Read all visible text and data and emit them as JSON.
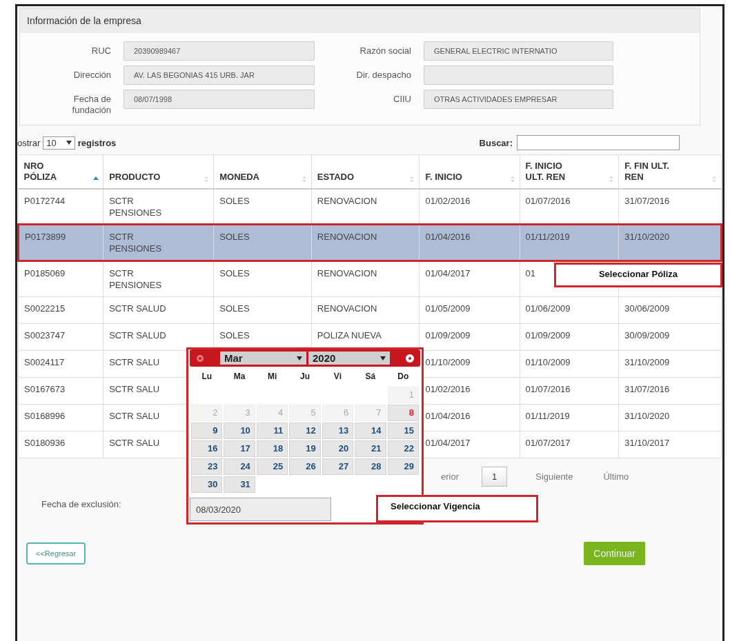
{
  "company_info": {
    "title": "Información de la empresa",
    "fields": [
      {
        "label": "RUC",
        "value": "20390989467"
      },
      {
        "label": "Razón social",
        "value": "GENERAL ELECTRIC INTERNATIO"
      },
      {
        "label": "Dirección",
        "value": "AV. LAS BEGONIAS 415 URB. JAR"
      },
      {
        "label": "Dir. despacho"
      },
      {
        "label": "Fecha de fundación",
        "value": "08/07/1998"
      },
      {
        "label": "CIIU",
        "value": "OTRAS ACTIVIDADES EMPRESAR"
      }
    ]
  },
  "table": {
    "length_menu": {
      "prefix": "ostrar",
      "value": "10",
      "suffix": "registros"
    },
    "search": {
      "label": "Buscar:"
    },
    "columns": [
      {
        "label": "NRO PÓLIZA",
        "sorted_ascending": true
      },
      {
        "label": "PRODUCTO",
        "sorted_ascending": false
      },
      {
        "label": "MONEDA",
        "sorted_ascending": false
      },
      {
        "label": "ESTADO",
        "sorted_ascending": false
      },
      {
        "label": "F. INICIO",
        "sorted_ascending": false
      },
      {
        "label": "F. INICIO ULT. REN",
        "sorted_ascending": false
      },
      {
        "label": "F. FIN ULT. REN",
        "sorted_ascending": false
      }
    ],
    "rows": [
      {
        "selected": false,
        "policy_no": "P0172744",
        "product": "SCTR PENSIONES",
        "currency": "SOLES",
        "status": "RENOVACION",
        "start": "01/02/2016",
        "renewal_start": "01/07/2016",
        "renewal_end": "31/07/2016"
      },
      {
        "selected": true,
        "callout": "Seleccionar Póliza",
        "policy_no": "P0173899",
        "product": "SCTR PENSIONES",
        "currency": "SOLES",
        "status": "RENOVACION",
        "start": "01/04/2016",
        "renewal_start": "01/11/2019",
        "renewal_end": "31/10/2020"
      },
      {
        "selected": false,
        "policy_no": "P0185069",
        "product": "SCTR PENSIONES",
        "currency": "SOLES",
        "status": "RENOVACION",
        "start": "01/04/2017",
        "renewal_start": "01"
      },
      {
        "selected": false,
        "policy_no": "S0022215",
        "product": "SCTR SALUD",
        "currency": "SOLES",
        "status": "RENOVACION",
        "start": "01/05/2009",
        "renewal_start": "01/06/2009",
        "renewal_end": "30/06/2009"
      },
      {
        "selected": false,
        "policy_no": "S0023747",
        "product": "SCTR SALUD",
        "currency": "SOLES",
        "status": "POLIZA NUEVA",
        "start": "01/09/2009",
        "renewal_start": "01/09/2009",
        "renewal_end": "30/09/2009"
      },
      {
        "selected": false,
        "policy_no": "S0024117",
        "product": "SCTR SALU",
        "start": "01/10/2009",
        "renewal_start": "01/10/2009",
        "renewal_end": "31/10/2009"
      },
      {
        "selected": false,
        "policy_no": "S0167673",
        "product": "SCTR SALU",
        "start": "01/02/2016",
        "renewal_start": "01/07/2016",
        "renewal_end": "31/07/2016"
      },
      {
        "selected": false,
        "policy_no": "S0168996",
        "product": "SCTR SALU",
        "start": "01/04/2016",
        "renewal_start": "01/11/2019",
        "renewal_end": "31/10/2020"
      },
      {
        "selected": false,
        "policy_no": "S0180936",
        "product": "SCTR SALU",
        "start": "01/04/2017",
        "renewal_start": "01/07/2017",
        "renewal_end": "31/10/2017"
      }
    ],
    "pagination": [
      {
        "label": "erior",
        "selected": false
      },
      {
        "label": "1",
        "selected": true
      },
      {
        "label": "Siguiente",
        "selected": false
      },
      {
        "label": "Último",
        "selected": false
      }
    ]
  },
  "calendar": {
    "month": "Mar",
    "year": "2020",
    "weekdays": [
      "Lu",
      "Ma",
      "Mi",
      "Ju",
      "Vi",
      "Sá",
      "Do"
    ],
    "weeks": [
      [
        {
          "kind": "blank"
        },
        {
          "kind": "blank"
        },
        {
          "kind": "blank"
        },
        {
          "kind": "blank"
        },
        {
          "kind": "blank"
        },
        {
          "kind": "blank"
        },
        {
          "kind": "day",
          "label": "1",
          "disabled": true,
          "today": false
        }
      ],
      [
        {
          "kind": "day",
          "label": "2",
          "disabled": true,
          "today": false
        },
        {
          "kind": "day",
          "label": "3",
          "disabled": true,
          "today": false
        },
        {
          "kind": "day",
          "label": "4",
          "disabled": true,
          "today": false
        },
        {
          "kind": "day",
          "label": "5",
          "disabled": true,
          "today": false
        },
        {
          "kind": "day",
          "label": "6",
          "disabled": true,
          "today": false
        },
        {
          "kind": "day",
          "label": "7",
          "disabled": true,
          "today": false
        },
        {
          "kind": "day",
          "label": "8",
          "disabled": false,
          "today": true
        }
      ],
      [
        {
          "kind": "day",
          "label": "9",
          "disabled": false,
          "today": false
        },
        {
          "kind": "day",
          "label": "10",
          "disabled": false,
          "today": false
        },
        {
          "kind": "day",
          "label": "11",
          "disabled": false,
          "today": false
        },
        {
          "kind": "day",
          "label": "12",
          "disabled": false,
          "today": false
        },
        {
          "kind": "day",
          "label": "13",
          "disabled": false,
          "today": false
        },
        {
          "kind": "day",
          "label": "14",
          "disabled": false,
          "today": false
        },
        {
          "kind": "day",
          "label": "15",
          "disabled": false,
          "today": false
        }
      ],
      [
        {
          "kind": "day",
          "label": "16",
          "disabled": false,
          "today": false
        },
        {
          "kind": "day",
          "label": "17",
          "disabled": false,
          "today": false
        },
        {
          "kind": "day",
          "label": "18",
          "disabled": false,
          "today": false
        },
        {
          "kind": "day",
          "label": "19",
          "disabled": false,
          "today": false
        },
        {
          "kind": "day",
          "label": "20",
          "disabled": false,
          "today": false
        },
        {
          "kind": "day",
          "label": "21",
          "disabled": false,
          "today": false
        },
        {
          "kind": "day",
          "label": "22",
          "disabled": false,
          "today": false
        }
      ],
      [
        {
          "kind": "day",
          "label": "23",
          "disabled": false,
          "today": false
        },
        {
          "kind": "day",
          "label": "24",
          "disabled": false,
          "today": false
        },
        {
          "kind": "day",
          "label": "25",
          "disabled": false,
          "today": false
        },
        {
          "kind": "day",
          "label": "26",
          "disabled": false,
          "today": false
        },
        {
          "kind": "day",
          "label": "27",
          "disabled": false,
          "today": false
        },
        {
          "kind": "day",
          "label": "28",
          "disabled": false,
          "today": false
        },
        {
          "kind": "day",
          "label": "29",
          "disabled": false,
          "today": false
        }
      ],
      [
        {
          "kind": "day",
          "label": "30",
          "disabled": false,
          "today": false
        },
        {
          "kind": "day",
          "label": "31",
          "disabled": false,
          "today": false
        },
        {
          "kind": "blank"
        },
        {
          "kind": "blank"
        },
        {
          "kind": "blank"
        },
        {
          "kind": "blank"
        },
        {
          "kind": "blank"
        }
      ]
    ]
  },
  "exclusion": {
    "label": "Fecha de exclusión:",
    "value": "08/03/2020",
    "callout": "Seleccionar Vigencia"
  },
  "buttons": [
    {
      "label": "<<Regresar",
      "kind": "secondary"
    },
    {
      "label": "Continuar",
      "kind": "primary"
    }
  ]
}
